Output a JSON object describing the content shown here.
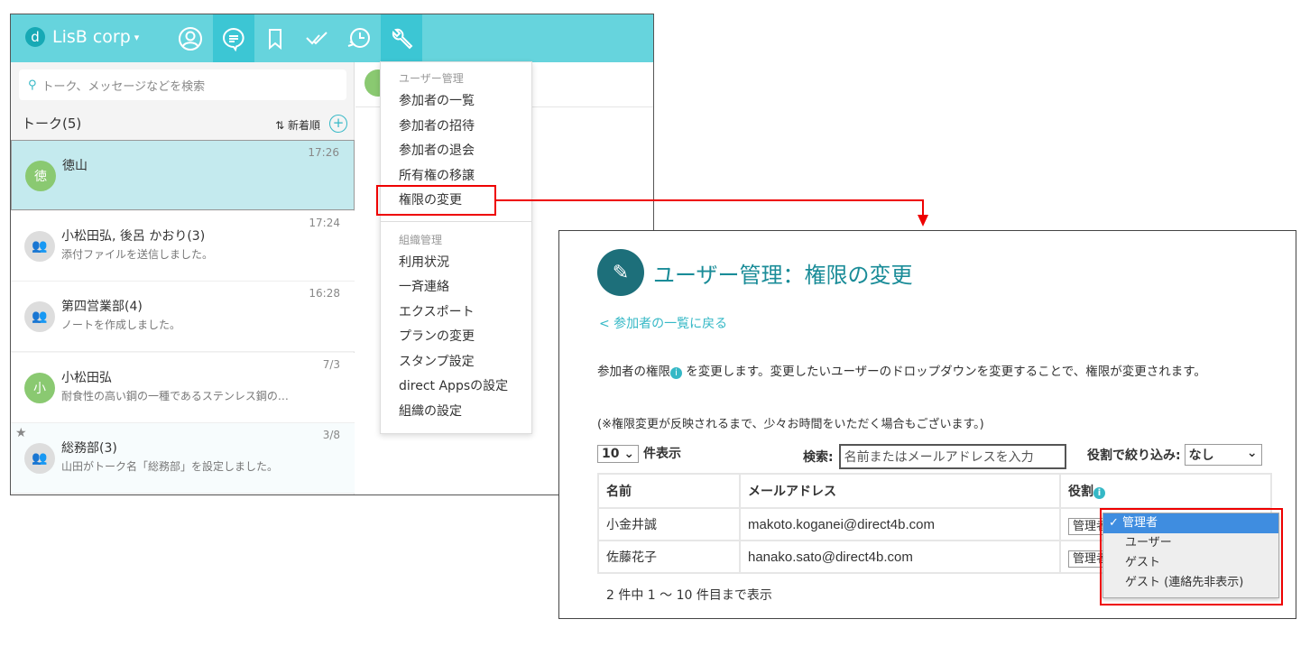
{
  "app": {
    "org": "LisB corp",
    "logo_letter": "d"
  },
  "search": {
    "placeholder": "トーク、メッセージなどを検索"
  },
  "talks": {
    "header": "トーク(5)",
    "sort": "新着順",
    "items": [
      {
        "name": "徳山",
        "msg": "",
        "time": "17:26",
        "avatar": "徳"
      },
      {
        "name": "小松田弘, 後呂 かおり(3)",
        "msg": "添付ファイルを送信しました。",
        "time": "17:24"
      },
      {
        "name": "第四営業部(4)",
        "msg": "ノートを作成しました。",
        "time": "16:28"
      },
      {
        "name": "小松田弘",
        "msg": "耐食性の高い鋼の一種であるステンレス鋼の…",
        "time": "7/3",
        "avatar": "小"
      },
      {
        "name": "総務部(3)",
        "msg": "山田がトーク名「総務部」を設定しました。",
        "time": "3/8"
      }
    ]
  },
  "menu": {
    "user_header": "ユーザー管理",
    "user_items": [
      "参加者の一覧",
      "参加者の招待",
      "参加者の退会",
      "所有権の移譲",
      "権限の変更"
    ],
    "org_header": "組織管理",
    "org_items": [
      "利用状況",
      "一斉連絡",
      "エクスポート",
      "プランの変更",
      "スタンプ設定",
      "direct Appsの設定",
      "組織の設定"
    ]
  },
  "panel": {
    "title": "ユーザー管理：権限の変更",
    "back": "< 参加者の一覧に戻る",
    "desc1": "参加者の権限",
    "desc2": " を変更します。変更したいユーザーのドロップダウンを変更することで、権限が変更されます。",
    "note": "(※権限変更が反映されるまで、少々お時間をいただく場合もございます。)",
    "page_size": "10",
    "page_size_label": "件表示",
    "search_label": "検索:",
    "search_placeholder": "名前またはメールアドレスを入力",
    "filter_label": "役割で絞り込み:",
    "filter_value": "なし",
    "columns": [
      "名前",
      "メールアドレス",
      "役割"
    ],
    "rows": [
      {
        "name": "小金井誠",
        "email": "makoto.koganei@direct4b.com",
        "role": "管理者"
      },
      {
        "name": "佐藤花子",
        "email": "hanako.sato@direct4b.com",
        "role": "管理者"
      }
    ],
    "footer": "2 件中 1 ～ 10 件目まで表示",
    "role_options": [
      "管理者",
      "ユーザー",
      "ゲスト",
      "ゲスト (連絡先非表示)"
    ],
    "selected_check": "✓"
  },
  "colors": {
    "header": "#66d4dd",
    "accent": "#35b8c6",
    "highlight": "#e00000"
  }
}
